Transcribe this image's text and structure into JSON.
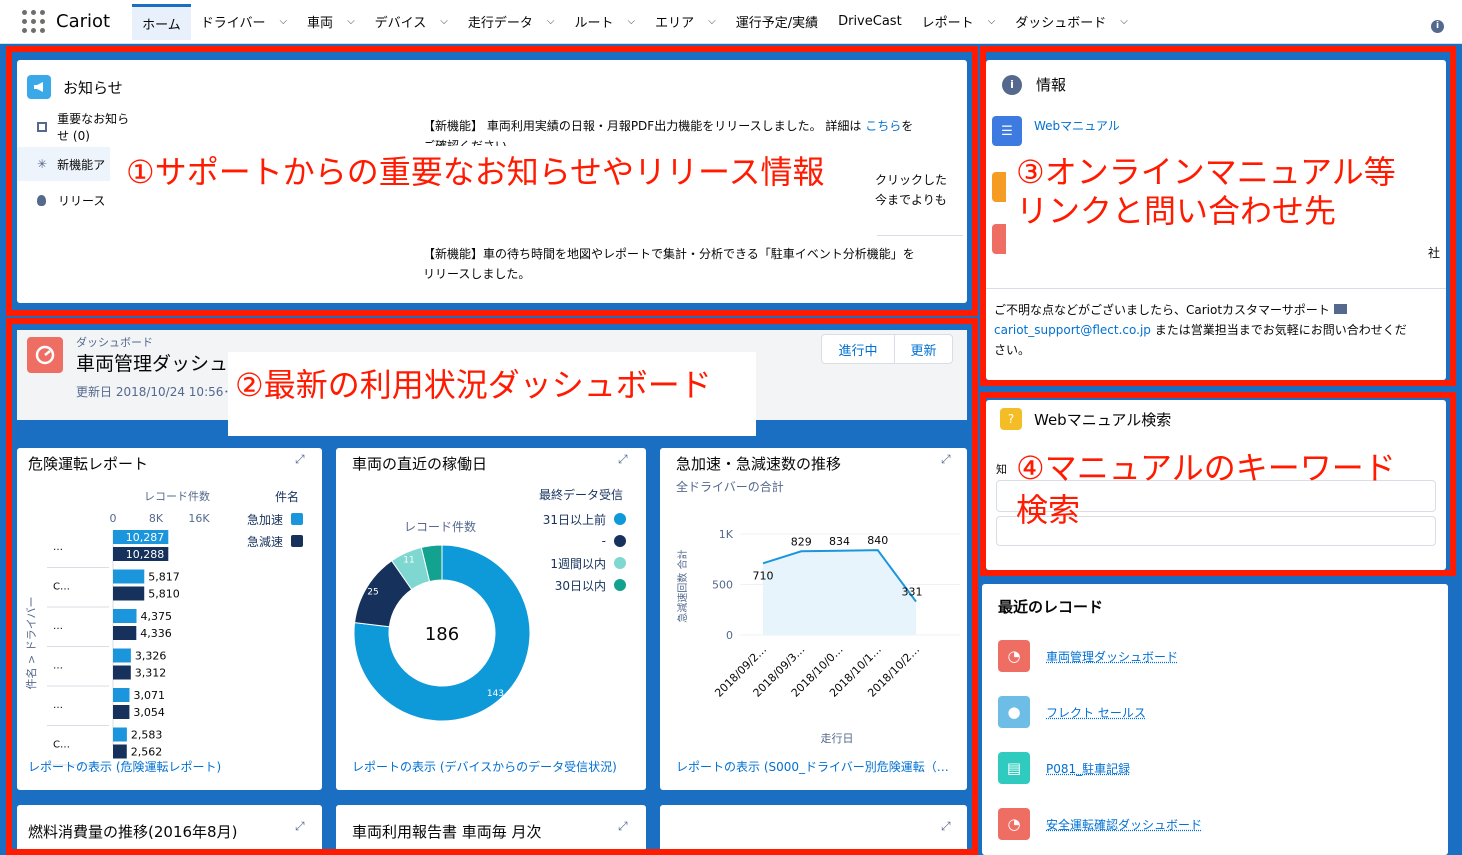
{
  "nav": {
    "app_name": "Cariot",
    "items": [
      {
        "label": "ホーム",
        "active": true,
        "dropdown": false
      },
      {
        "label": "ドライバー",
        "dropdown": true
      },
      {
        "label": "車両",
        "dropdown": true
      },
      {
        "label": "デバイス",
        "dropdown": true
      },
      {
        "label": "走行データ",
        "dropdown": true
      },
      {
        "label": "ルート",
        "dropdown": true
      },
      {
        "label": "エリア",
        "dropdown": true
      },
      {
        "label": "運行予定/実績",
        "dropdown": false
      },
      {
        "label": "DriveCast",
        "dropdown": false
      },
      {
        "label": "レポート",
        "dropdown": true
      },
      {
        "label": "ダッシュボード",
        "dropdown": true
      }
    ],
    "info_icon": "i"
  },
  "notices": {
    "title": "お知らせ",
    "tabs": [
      "重要なお知らせ (0)",
      "新機能ア",
      "リリース"
    ],
    "item1_prefix": "【新機能】 車両利用実績の日報・月報PDF出力機能をリリースしました。 詳細は ",
    "item1_link": "こちら",
    "item1_suffix": "を",
    "item1_line2": "ご確認ください。",
    "item2_line1": "クリックした",
    "item2_line2": "今までよりも",
    "item3_line1": "【新機能】車の待ち時間を地図やレポートで集計・分析できる「駐車イベント分析機能」を",
    "item3_line2": "リリースしました。"
  },
  "annotations": {
    "a1": "①サポートからの重要なお知らせやリリース情報",
    "a2": "②最新の利用状況ダッシュボード",
    "a3_line1": "③オンラインマニュアル等",
    "a3_line2": "リンクと問い合わせ先",
    "a4_line1": "④マニュアルのキーワード",
    "a4_line2": "検索"
  },
  "dashboard": {
    "breadcrumb": "ダッシュボード",
    "title": "車両管理ダッシュ",
    "updated": "更新日 2018/10/24 10:56･フ",
    "btn_in_progress": "進行中",
    "btn_refresh": "更新"
  },
  "widgets": {
    "w1": {
      "title": "危険運転レポート",
      "footer": "レポートの表示 (危険運転レポート)"
    },
    "w2": {
      "title": "車両の直近の稼働日",
      "footer": "レポートの表示 (デバイスからのデータ受信状況)"
    },
    "w3": {
      "title": "急加速・急減速数の推移",
      "subtitle": "全ドライバーの合計",
      "footer": "レポートの表示 (S000_ドライバー別危険運転（…"
    },
    "w4": {
      "title": "燃料消費量の推移(2016年8月)"
    },
    "w5": {
      "title": "車両利用報告書 車両毎 月次"
    }
  },
  "info": {
    "title": "情報",
    "web_manual_link": "Webマニュアル",
    "right_fragment": "社",
    "contact_prefix": "ご不明な点などがございましたら、Cariotカスタマーサポート",
    "contact_email": "cariot_support@flect.co.jp",
    "contact_suffix": "または営業担当までお気軽にお問い合わせくだ",
    "contact_line3": "さい。"
  },
  "manual_search": {
    "title": "Webマニュアル検索",
    "label_fragment": "知"
  },
  "recent": {
    "title": "最近のレコード",
    "items": [
      {
        "label": "車両管理ダッシュボード",
        "icon": "dashboard-icon",
        "color": "#ef6e64"
      },
      {
        "label": "フレクト セールス",
        "icon": "user-icon",
        "color": "#6dbde6"
      },
      {
        "label": "P081_駐車記録",
        "icon": "report-icon",
        "color": "#2ecbbe"
      },
      {
        "label": "安全運転確認ダッシュボード",
        "icon": "dashboard-icon",
        "color": "#ef6e64"
      }
    ]
  },
  "chart_data": [
    {
      "type": "bar",
      "title": "危険運転レポート",
      "xlabel": "レコード件数",
      "ylabel": "件名 > ドライバー",
      "xticks": [
        "0",
        "8K",
        "16K"
      ],
      "xlim": [
        0,
        16000
      ],
      "legend_title": "件名",
      "category_labels": [
        "…",
        "C…",
        "…",
        "…",
        "…",
        "C…"
      ],
      "series": [
        {
          "name": "急加速",
          "color": "#1b96dc",
          "values": [
            10287,
            5817,
            4375,
            3326,
            3071,
            2583
          ]
        },
        {
          "name": "急減速",
          "color": "#16325c",
          "values": [
            10288,
            5810,
            4336,
            3312,
            3054,
            2562
          ]
        }
      ]
    },
    {
      "type": "pie",
      "title": "車両の直近の稼働日",
      "center_label": "レコード件数",
      "total": "186",
      "legend_title": "最終データ受信",
      "slices": [
        {
          "label": "31日以上前",
          "value": 143,
          "color": "#0e99d9"
        },
        {
          "label": "-",
          "value": 25,
          "color": "#16325c"
        },
        {
          "label": "1週間以内",
          "value": 11,
          "color": "#7ed8d1"
        },
        {
          "label": "30日以内",
          "value": 7,
          "color": "#12a28f"
        }
      ]
    },
    {
      "type": "area",
      "title": "急加速・急減速数の推移",
      "subtitle": "全ドライバーの合計",
      "xlabel": "走行日",
      "ylabel": "急減速回数 合計",
      "ylim": [
        0,
        1000
      ],
      "yticks": [
        "0",
        "500",
        "1K"
      ],
      "x": [
        "2018/09/2…",
        "2018/09/3…",
        "2018/10/0…",
        "2018/10/1…",
        "2018/10/2…"
      ],
      "values": [
        710,
        829,
        834,
        840,
        331
      ]
    }
  ]
}
